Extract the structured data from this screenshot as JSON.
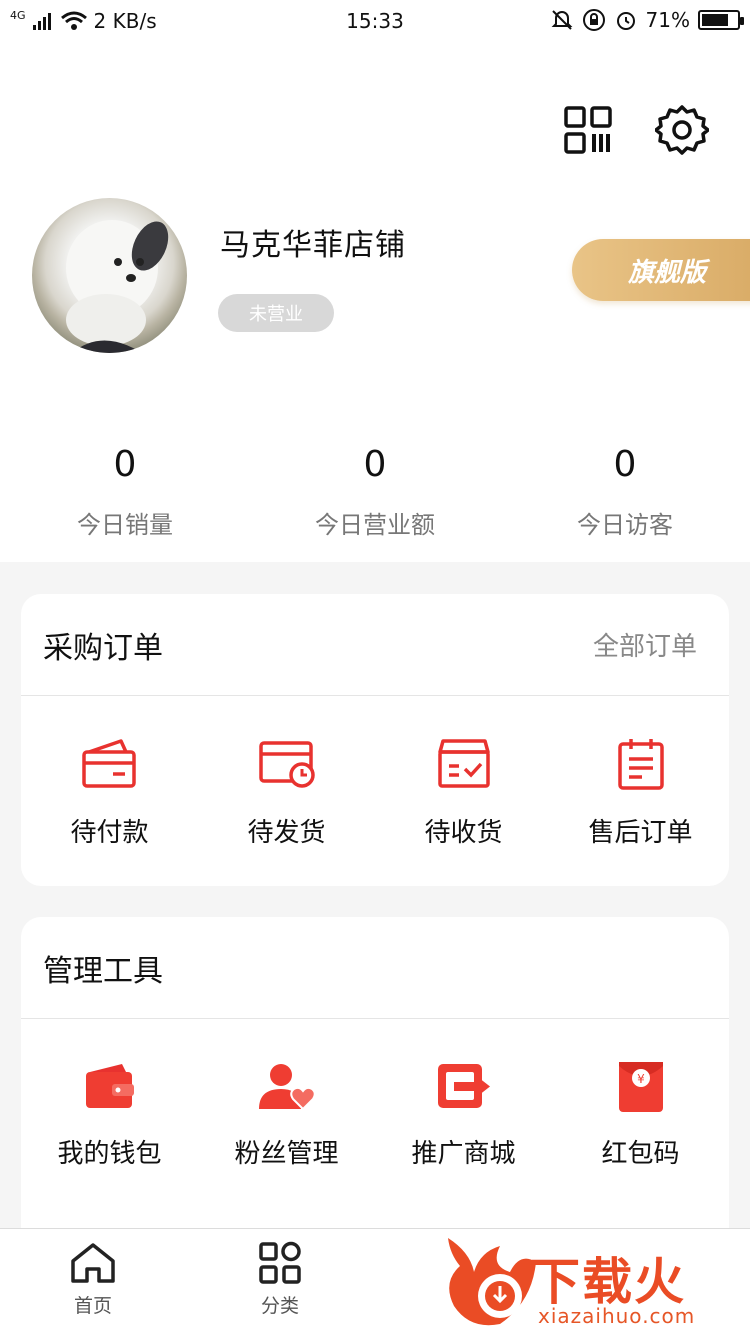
{
  "status_bar": {
    "network": "4G",
    "speed": "2 KB/s",
    "time": "15:33",
    "battery": "71%"
  },
  "header": {
    "shop_name": "马克华菲店铺",
    "shop_status": "未营业",
    "vip_badge": "旗舰版"
  },
  "stats": [
    {
      "value": "0",
      "label": "今日销量"
    },
    {
      "value": "0",
      "label": "今日营业额"
    },
    {
      "value": "0",
      "label": "今日访客"
    }
  ],
  "purchase_orders": {
    "title": "采购订单",
    "link": "全部订单",
    "items": [
      {
        "label": "待付款",
        "icon": "card-wallet-icon"
      },
      {
        "label": "待发货",
        "icon": "card-clock-icon"
      },
      {
        "label": "待收货",
        "icon": "box-check-icon"
      },
      {
        "label": "售后订单",
        "icon": "clipboard-list-icon"
      }
    ]
  },
  "tools": {
    "title": "管理工具",
    "items": [
      {
        "label": "我的钱包",
        "icon": "wallet-icon"
      },
      {
        "label": "粉丝管理",
        "icon": "user-heart-icon"
      },
      {
        "label": "推广商城",
        "icon": "share-arrow-icon"
      },
      {
        "label": "红包码",
        "icon": "red-envelope-icon"
      }
    ]
  },
  "tabbar": {
    "items": [
      {
        "label": "首页",
        "icon": "home-icon"
      },
      {
        "label": "分类",
        "icon": "category-icon"
      }
    ]
  },
  "watermark": {
    "brand": "下载火",
    "domain": "xiazaihuo.com"
  },
  "colors": {
    "accent": "#e8322f",
    "gold": "#dcb06b",
    "background": "#f5f5f5"
  }
}
